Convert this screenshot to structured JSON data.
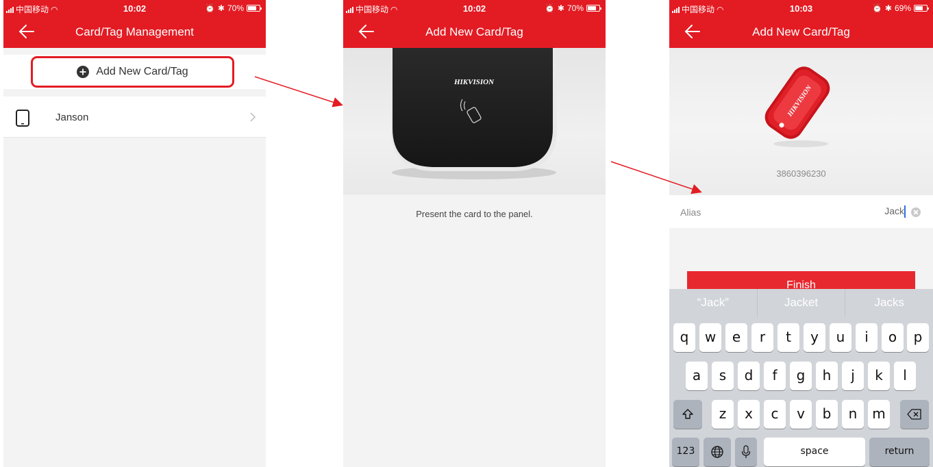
{
  "status_bars": [
    {
      "carrier": "中国移动",
      "time": "10:02",
      "battery": "70%",
      "battery_level": 0.7
    },
    {
      "carrier": "中国移动",
      "time": "10:02",
      "battery": "70%",
      "battery_level": 0.7
    },
    {
      "carrier": "中国移动",
      "time": "10:03",
      "battery": "69%",
      "battery_level": 0.69
    }
  ],
  "screen1": {
    "title": "Card/Tag Management",
    "add_label": "Add New Card/Tag",
    "items": [
      {
        "label": "Janson"
      }
    ]
  },
  "screen2": {
    "title": "Add New Card/Tag",
    "brand": "HIKVISION",
    "instruction": "Present the card to the panel."
  },
  "screen3": {
    "title": "Add New Card/Tag",
    "brand": "HIKVISION",
    "serial": "3860396230",
    "alias_label": "Alias",
    "alias_value": "Jack",
    "finish_label": "Finish",
    "suggestions": [
      "“Jack”",
      "Jacket",
      "Jacks"
    ],
    "keys": {
      "row1": [
        "q",
        "w",
        "e",
        "r",
        "t",
        "y",
        "u",
        "i",
        "o",
        "p"
      ],
      "row2": [
        "a",
        "s",
        "d",
        "f",
        "g",
        "h",
        "j",
        "k",
        "l"
      ],
      "row3": [
        "z",
        "x",
        "c",
        "v",
        "b",
        "n",
        "m"
      ],
      "numbers": "123",
      "space": "space",
      "return": "return"
    }
  },
  "colors": {
    "brand_red": "#e31b23",
    "keyboard_bg": "#d1d4d9"
  }
}
